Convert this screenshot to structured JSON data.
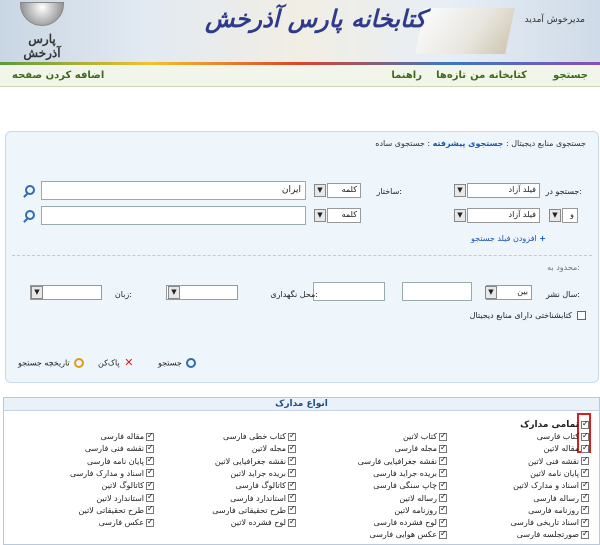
{
  "header": {
    "logo_text": "پارس آذرخش",
    "banner_title": "کتابخانه پارس آذرخش",
    "welcome": "مدیرخوش آمدید"
  },
  "nav": {
    "add_page": "اضافه کردن صفحه",
    "search": "جستجو",
    "my_library": "کتابخانه من",
    "news": "تازه‌ها",
    "guide": "راهنما"
  },
  "tabs": {
    "simple": "جستجوی ساده",
    "advanced": "جستجوی پیشرفته",
    "digital": "جستجوی منابع دیجیتال",
    "separator": ":"
  },
  "form": {
    "search_in_label": "جستجو در:",
    "structure_label": "ساختار:",
    "row1": {
      "field": "فیلد آزاد",
      "structure": "کلمه",
      "value": "ایران"
    },
    "row2": {
      "operator": "و",
      "field": "فیلد آزاد",
      "structure": "کلمه",
      "value": ""
    },
    "add_field": "افزودن فیلد جستجو",
    "restrict_label": "محدود به:",
    "pub_year_label": "سال نشر:",
    "between": "بین",
    "location_label": "محل نگهداری:",
    "language_label": "زبان:",
    "digital_only": "کتابشناختی دارای منابع دیجیتال",
    "buttons": {
      "search": "جستجو",
      "clear": "پاک‌کن",
      "history": "تاریخچه جستجو"
    }
  },
  "document_types": {
    "title": "انواع مدارک",
    "all": "تمامی مدارک",
    "col1": [
      "کتاب فارسی",
      "مقاله لاتین",
      "نقشه فنی لاتین",
      "پایان نامه لاتین",
      "اسناد و مدارک لاتین",
      "رساله فارسی",
      "روزنامه فارسی",
      "اسناد تاریخی فارسی",
      "صورتجلسه فارسی"
    ],
    "col2": [
      "کتاب لاتین",
      "مجله فارسی",
      "نقشه جغرافیایی فارسی",
      "بریده جراید فارسی",
      "چاپ سنگی فارسی",
      "رساله لاتین",
      "روزنامه لاتین",
      "لوح فشرده فارسی",
      "عکس هوایی فارسی"
    ],
    "col3": [
      "کتاب خطی فارسی",
      "مجله لاتین",
      "نقشه جغرافیایی لاتین",
      "بریده جراید لاتین",
      "کاتالوگ فارسی",
      "استاندارد فارسی",
      "طرح تحقیقاتی فارسی",
      "لوح فشرده لاتین"
    ],
    "col4": [
      "مقاله فارسی",
      "نقشه فنی فارسی",
      "پایان نامه فارسی",
      "اسناد و مدارک فارسی",
      "کاتالوگ لاتین",
      "استاندارد لاتین",
      "طرح تحقیقاتی لاتین",
      "عکس فارسی"
    ]
  }
}
